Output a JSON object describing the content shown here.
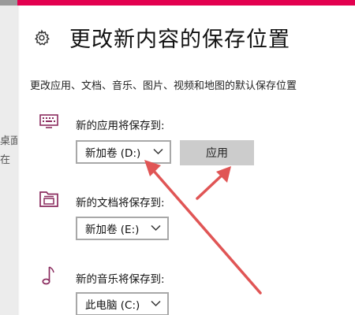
{
  "page": {
    "title": "更改新内容的保存位置",
    "description": "更改应用、文档、音乐、图片、视频和地图的默认保存位置"
  },
  "background_window": {
    "fragments": [
      "桌面",
      "在"
    ]
  },
  "sections": [
    {
      "label": "新的应用将保存到:",
      "selected": "新加卷 (D:)",
      "icon": "monitor-icon"
    },
    {
      "label": "新的文档将保存到:",
      "selected": "新加卷 (E:)",
      "icon": "folder-icon"
    },
    {
      "label": "新的音乐将保存到:",
      "selected": "此电脑 (C:)",
      "icon": "music-note-icon"
    }
  ],
  "apply_button": {
    "label": "应用"
  },
  "colors": {
    "accent_strip": "#e3004f",
    "icon_purple": "#8a2b5e",
    "arrow_red": "#e05555",
    "button_gray": "#cccccc"
  }
}
